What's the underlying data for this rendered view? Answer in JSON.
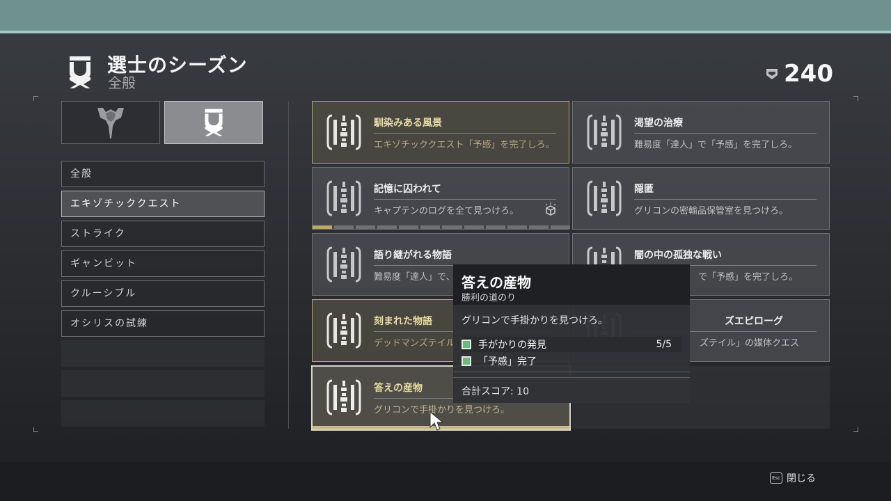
{
  "header": {
    "title": "選士のシーズン",
    "subtitle": "全般",
    "score": "240"
  },
  "nav": {
    "items": [
      "全般",
      "エキゾチッククエスト",
      "ストライク",
      "ギャンビット",
      "クルーシブル",
      "オシリスの試練"
    ],
    "active_index": 1
  },
  "cards": [
    {
      "title": "馴染みある風景",
      "desc": "エキゾチッククエスト「予感」を完了しろ。"
    },
    {
      "title": "渇望の治療",
      "desc": "難易度「達人」で「予感」を完了しろ。"
    },
    {
      "title": "記憶に囚われて",
      "desc": "キャプテンのログを全て見つけろ。"
    },
    {
      "title": "隠匿",
      "desc": "グリコンの密輸品保管室を見つけろ。"
    },
    {
      "title": "語り継がれる物語",
      "desc": "難易度「達人」で、く「予感」を完了し"
    },
    {
      "title": "闇の中の孤独な戦い",
      "desc": "で「予感」を完了しろ。"
    },
    {
      "title": "刻まれた物語",
      "desc": "デッドマンズテイル"
    },
    {
      "title": "ズエピローグ",
      "desc": "ズテイル」の媒体クエス"
    },
    {
      "title": "答えの産物",
      "desc": "グリコンで手掛かりを見つけろ。"
    }
  ],
  "tooltip": {
    "title": "答えの産物",
    "subtitle": "勝利の道のり",
    "desc": "グリコンで手掛かりを見つけろ。",
    "objectives": [
      {
        "label": "手がかりの発見",
        "count": "5/5"
      },
      {
        "label": "「予感」完了",
        "count": ""
      }
    ],
    "total": "合計スコア: 10"
  },
  "footer": {
    "close_label": "閉じる",
    "esc_label": "Esc"
  },
  "colors": {
    "accent_gold": "#b9a86c",
    "top_bar": "#6f9190",
    "check_green": "#6fb87e"
  }
}
